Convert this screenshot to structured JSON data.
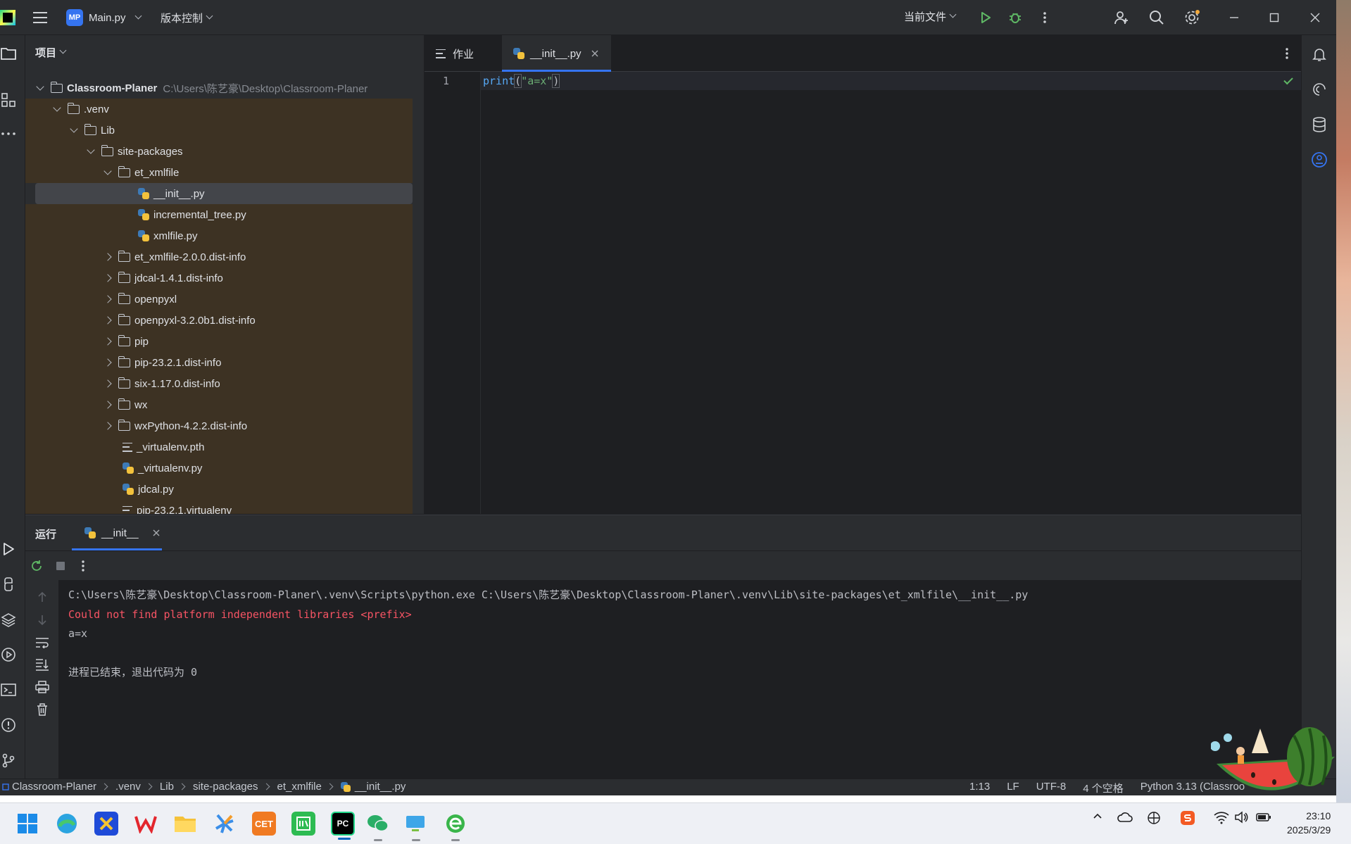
{
  "titlebar": {
    "project_badge": "MP",
    "project_name": "Main.py",
    "vcs_label": "版本控制",
    "run_config": "当前文件"
  },
  "project_panel": {
    "title": "项目",
    "tree": [
      {
        "label": "Classroom-Planer",
        "hint": "C:\\Users\\陈艺豪\\Desktop\\Classroom-Planer"
      },
      {
        "label": ".venv"
      },
      {
        "label": "Lib"
      },
      {
        "label": "site-packages"
      },
      {
        "label": "et_xmlfile"
      },
      {
        "label": "__init__.py"
      },
      {
        "label": "incremental_tree.py"
      },
      {
        "label": "xmlfile.py"
      },
      {
        "label": "et_xmlfile-2.0.0.dist-info"
      },
      {
        "label": "jdcal-1.4.1.dist-info"
      },
      {
        "label": "openpyxl"
      },
      {
        "label": "openpyxl-3.2.0b1.dist-info"
      },
      {
        "label": "pip"
      },
      {
        "label": "pip-23.2.1.dist-info"
      },
      {
        "label": "six-1.17.0.dist-info"
      },
      {
        "label": "wx"
      },
      {
        "label": "wxPython-4.2.2.dist-info"
      },
      {
        "label": "_virtualenv.pth"
      },
      {
        "label": "_virtualenv.py"
      },
      {
        "label": "jdcal.py"
      },
      {
        "label": "pip-23.2.1.virtualenv"
      }
    ]
  },
  "editor": {
    "tabs": [
      {
        "label": "作业"
      },
      {
        "label": "__init__.py"
      }
    ],
    "line_number": "1",
    "code": {
      "func": "print",
      "open": "(",
      "string": "\"a=x\"",
      "close": ")"
    }
  },
  "run_panel": {
    "title": "运行",
    "tab_label": "__init__",
    "console": {
      "command": "C:\\Users\\陈艺豪\\Desktop\\Classroom-Planer\\.venv\\Scripts\\python.exe C:\\Users\\陈艺豪\\Desktop\\Classroom-Planer\\.venv\\Lib\\site-packages\\et_xmlfile\\__init__.py",
      "error": "Could not find platform independent libraries <prefix>",
      "output": "a=x",
      "exit": "进程已结束，退出代码为 0"
    }
  },
  "statusbar": {
    "breadcrumbs": [
      "Classroom-Planer",
      ".venv",
      "Lib",
      "site-packages",
      "et_xmlfile",
      "__init__.py"
    ],
    "position": "1:13",
    "line_sep": "LF",
    "encoding": "UTF-8",
    "indent": "4 个空格",
    "interpreter": "Python 3.13 (Classroo"
  },
  "taskbar": {
    "time": "23:10",
    "date": "2025/3/29"
  },
  "colors": {
    "accent": "#3574f0",
    "error_text": "#f75464",
    "string": "#6aab73",
    "excluded_bg": "#3d3223"
  }
}
